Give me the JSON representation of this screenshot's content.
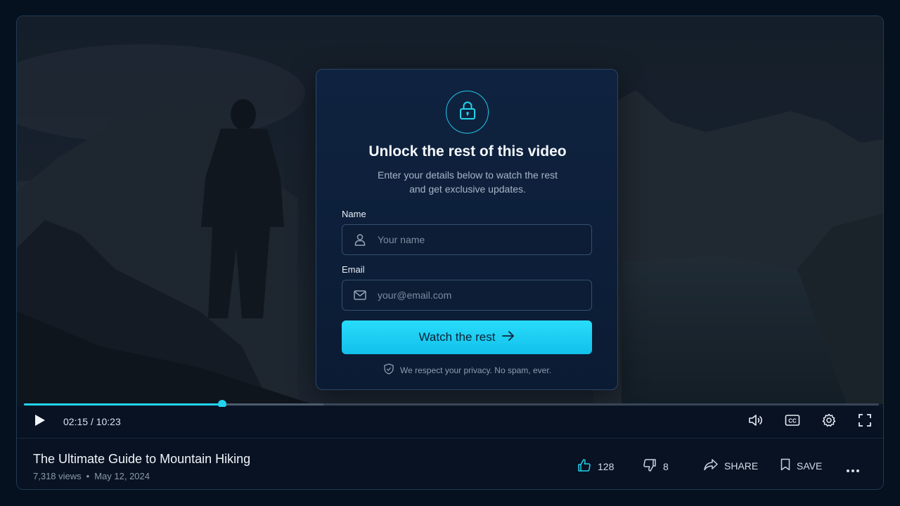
{
  "player": {
    "current_time": "02:15",
    "separator": "/",
    "duration": "10:23",
    "progress_fraction": 0.232,
    "buffered_fraction": 0.35
  },
  "gate": {
    "heading": "Unlock the rest of this video",
    "subtext_line1": "Enter your details below to watch the rest",
    "subtext_line2": "and get exclusive updates.",
    "name_label": "Name",
    "name_placeholder": "Your name",
    "email_label": "Email",
    "email_placeholder": "your@email.com",
    "cta_label": "Watch the rest",
    "privacy_note": "We respect your privacy. No spam, ever."
  },
  "video": {
    "title": "The Ultimate Guide to Mountain Hiking",
    "views": "7,318 views",
    "meta_separator": "•",
    "date": "May 12, 2024"
  },
  "actions": {
    "likes": "128",
    "dislikes": "8",
    "share_label": "SHARE",
    "save_label": "SAVE"
  },
  "icons": {
    "play": "play-icon",
    "volume": "volume-icon",
    "captions": "cc-icon",
    "settings": "gear-icon",
    "fullscreen": "fullscreen-icon",
    "lock": "lock-icon",
    "user": "user-icon",
    "mail": "mail-icon",
    "arrow": "arrow-right-icon",
    "shield": "shield-check-icon",
    "thumbs_up": "thumbs-up-icon",
    "thumbs_down": "thumbs-down-icon",
    "share": "share-icon",
    "bookmark": "bookmark-icon",
    "more": "more-icon"
  },
  "colors": {
    "accent": "#22d3ee",
    "background": "#06111f",
    "card": "#0d1f3a"
  }
}
